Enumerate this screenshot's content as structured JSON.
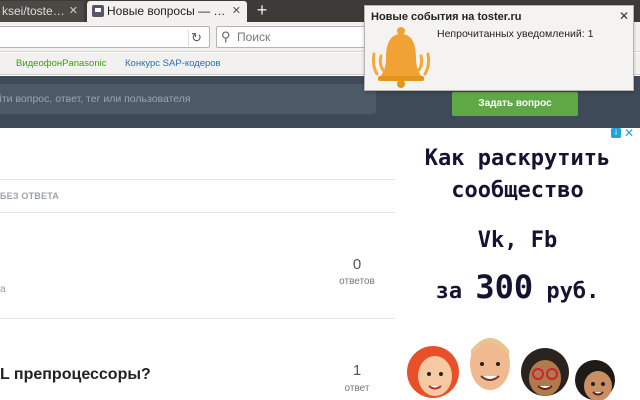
{
  "browser": {
    "tabs": [
      {
        "label": "ksei/toste…",
        "active": false
      },
      {
        "label": "Новые вопросы — …",
        "active": true
      }
    ],
    "search_placeholder": "Поиск",
    "bookmarks": [
      "ВидеофонPanasonic",
      "Конкурс SAP-кодеров"
    ],
    "colors": {
      "tabbar": "#3c3b37",
      "bookmark_green": "#3a9f10",
      "bookmark_blue": "#2d6cb8"
    }
  },
  "notification": {
    "title": "Новые события на toster.ru",
    "message": "Непрочитанных уведомлений: 1",
    "icon": "bell-icon",
    "close_glyph": "✕"
  },
  "site": {
    "search_placeholder": "йти вопрос, ответ, тег или пользователя",
    "ask_button": "Задать вопрос",
    "filter_label": "БЕЗ ОТВЕТА",
    "colors": {
      "header": "#3e4a57",
      "ask_button": "#5ea946"
    },
    "questions": [
      {
        "title": "",
        "meta": "а",
        "count": "0",
        "count_label": "ответов"
      },
      {
        "title": "L препроцессоры?",
        "meta": "",
        "count": "1",
        "count_label": "ответ"
      }
    ]
  },
  "ad": {
    "line1": "Как раскрутить",
    "line2": "сообщество",
    "line3": "Vk, Fb",
    "line4_prefix": "за",
    "line4_number": "300",
    "line4_suffix": "руб.",
    "info_glyph": "i",
    "close_glyph": "✕"
  }
}
